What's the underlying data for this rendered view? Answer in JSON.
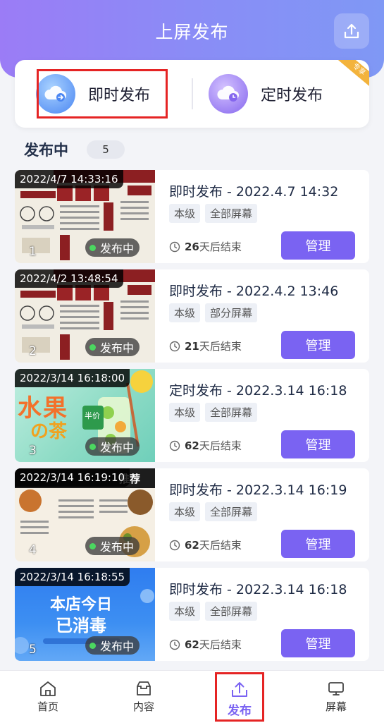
{
  "header": {
    "title": "上屏发布",
    "upload_icon": "upload-icon"
  },
  "modes": {
    "instant": {
      "label": "即时发布",
      "icon": "cloud-send-icon"
    },
    "timed": {
      "label": "定时发布",
      "icon": "cloud-clock-icon"
    },
    "vip_badge": "专享"
  },
  "section": {
    "title": "发布中",
    "count": "5"
  },
  "items": [
    {
      "timestamp": "2022/4/7 14:33:16",
      "index": "1",
      "status": "发布中",
      "title": "即时发布 - 2022.4.7 14:32",
      "tag_level": "本级",
      "tag_scope": "全部屏幕",
      "days": "26",
      "remain_suffix": "天后结束",
      "manage": "管理"
    },
    {
      "timestamp": "2022/4/2 13:48:54",
      "index": "2",
      "status": "发布中",
      "title": "即时发布 - 2022.4.2 13:46",
      "tag_level": "本级",
      "tag_scope": "部分屏幕",
      "days": "21",
      "remain_suffix": "天后结束",
      "manage": "管理"
    },
    {
      "timestamp": "2022/3/14 16:18:00",
      "index": "3",
      "status": "发布中",
      "title": "定时发布 - 2022.3.14 16:18",
      "tag_level": "本级",
      "tag_scope": "全部屏幕",
      "days": "62",
      "remain_suffix": "天后结束",
      "manage": "管理"
    },
    {
      "timestamp": "2022/3/14 16:19:10",
      "index": "4",
      "status": "发布中",
      "title": "即时发布 - 2022.3.14 16:19",
      "tag_level": "本级",
      "tag_scope": "全部屏幕",
      "days": "62",
      "remain_suffix": "天后结束",
      "manage": "管理"
    },
    {
      "timestamp": "2022/3/14 16:18:55",
      "index": "5",
      "status": "发布中",
      "title": "即时发布 - 2022.3.14 16:18",
      "tag_level": "本级",
      "tag_scope": "全部屏幕",
      "days": "62",
      "remain_suffix": "天后结束",
      "manage": "管理"
    }
  ],
  "thumbnail_texts": {
    "fruit_big": "水果",
    "fruit_small": "の茶",
    "fruit_badge": "半价",
    "bbq_banner": "推荐",
    "blue_line1": "本店今日",
    "blue_line2": "已消毒"
  },
  "tabbar": {
    "home": "首页",
    "content": "内容",
    "publish": "发布",
    "screen": "屏幕"
  },
  "colors": {
    "accent": "#7a63f2",
    "header_gradient_start": "#9b7cf6",
    "header_gradient_end": "#7f98f5",
    "status_dot": "#4bd860",
    "highlight": "#e52424"
  }
}
